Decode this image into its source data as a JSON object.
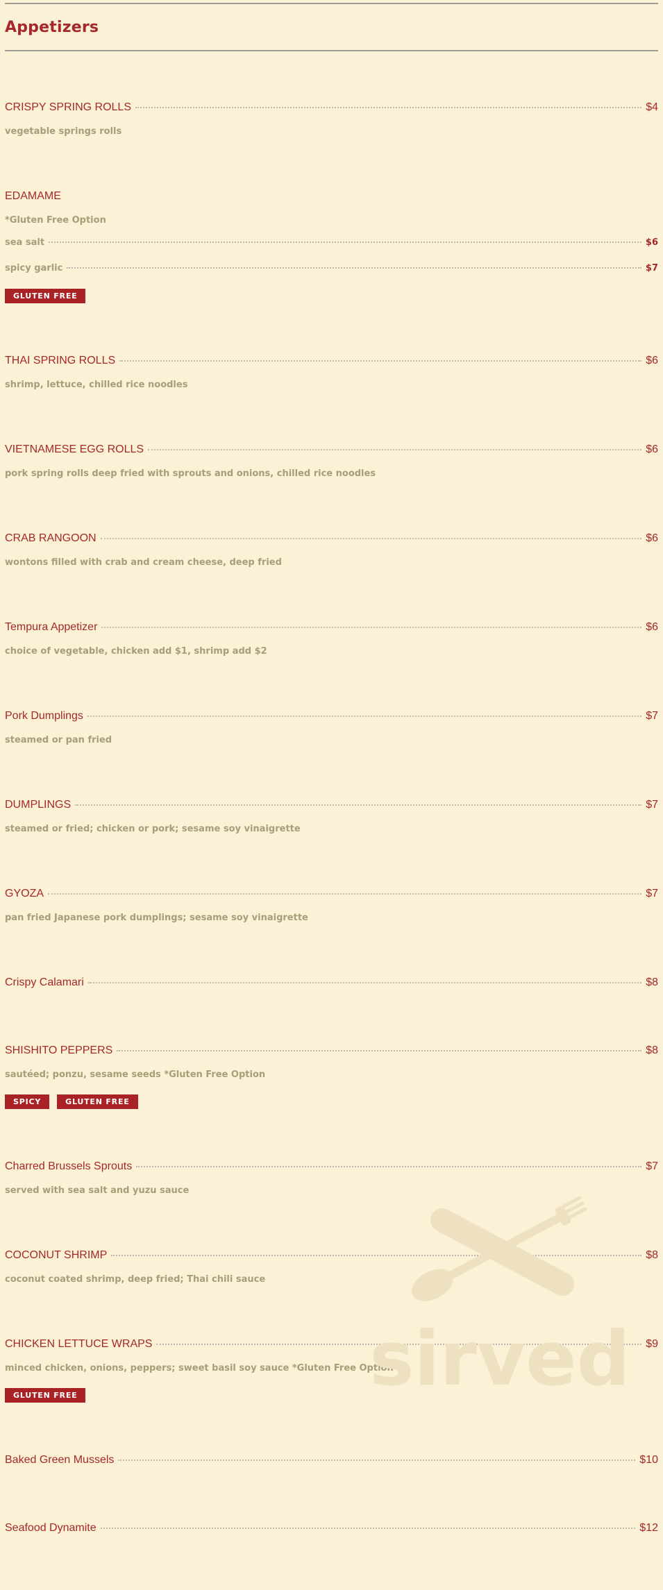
{
  "section": {
    "title": "Appetizers"
  },
  "items": [
    {
      "name": "CRISPY SPRING ROLLS",
      "price": "$4",
      "desc": "vegetable springs rolls"
    },
    {
      "name": "EDAMAME",
      "price": "",
      "desc": "*Gluten Free Option",
      "options": [
        {
          "name": "sea salt",
          "price": "$6"
        },
        {
          "name": "spicy garlic",
          "price": "$7"
        }
      ],
      "tags": [
        "GLUTEN FREE"
      ]
    },
    {
      "name": "THAI SPRING ROLLS",
      "price": "$6",
      "desc": "shrimp, lettuce, chilled rice noodles"
    },
    {
      "name": "VIETNAMESE EGG ROLLS",
      "price": "$6",
      "desc": "pork spring rolls deep fried with sprouts and onions, chilled rice noodles"
    },
    {
      "name": "CRAB RANGOON",
      "price": "$6",
      "desc": "wontons filled with crab and cream cheese, deep fried"
    },
    {
      "name": "Tempura Appetizer",
      "price": "$6",
      "desc": "choice of vegetable, chicken add $1, shrimp add $2"
    },
    {
      "name": "Pork Dumplings",
      "price": "$7",
      "desc": "steamed or pan fried"
    },
    {
      "name": "DUMPLINGS",
      "price": "$7",
      "desc": "steamed or fried; chicken or pork; sesame soy vinaigrette"
    },
    {
      "name": "GYOZA",
      "price": "$7",
      "desc": "pan fried Japanese pork dumplings; sesame soy vinaigrette"
    },
    {
      "name": "Crispy Calamari",
      "price": "$8",
      "desc": ""
    },
    {
      "name": "SHISHITO PEPPERS",
      "price": "$8",
      "desc": "sautéed; ponzu, sesame seeds *Gluten Free Option",
      "tags": [
        "SPICY",
        "GLUTEN FREE"
      ]
    },
    {
      "name": "Charred Brussels Sprouts",
      "price": "$7",
      "desc": "served with sea salt and yuzu sauce"
    },
    {
      "name": "COCONUT SHRIMP",
      "price": "$8",
      "desc": "coconut coated shrimp, deep fried; Thai chili sauce"
    },
    {
      "name": "CHICKEN LETTUCE WRAPS",
      "price": "$9",
      "desc": "minced chicken, onions, peppers; sweet basil soy sauce *Gluten Free Option",
      "tags": [
        "GLUTEN FREE"
      ]
    },
    {
      "name": "Baked Green Mussels",
      "price": "$10",
      "desc": ""
    },
    {
      "name": "Seafood Dynamite",
      "price": "$12",
      "desc": ""
    }
  ],
  "watermark": {
    "text": "sirved",
    "icon": "fork-spoon-knife-icon"
  }
}
